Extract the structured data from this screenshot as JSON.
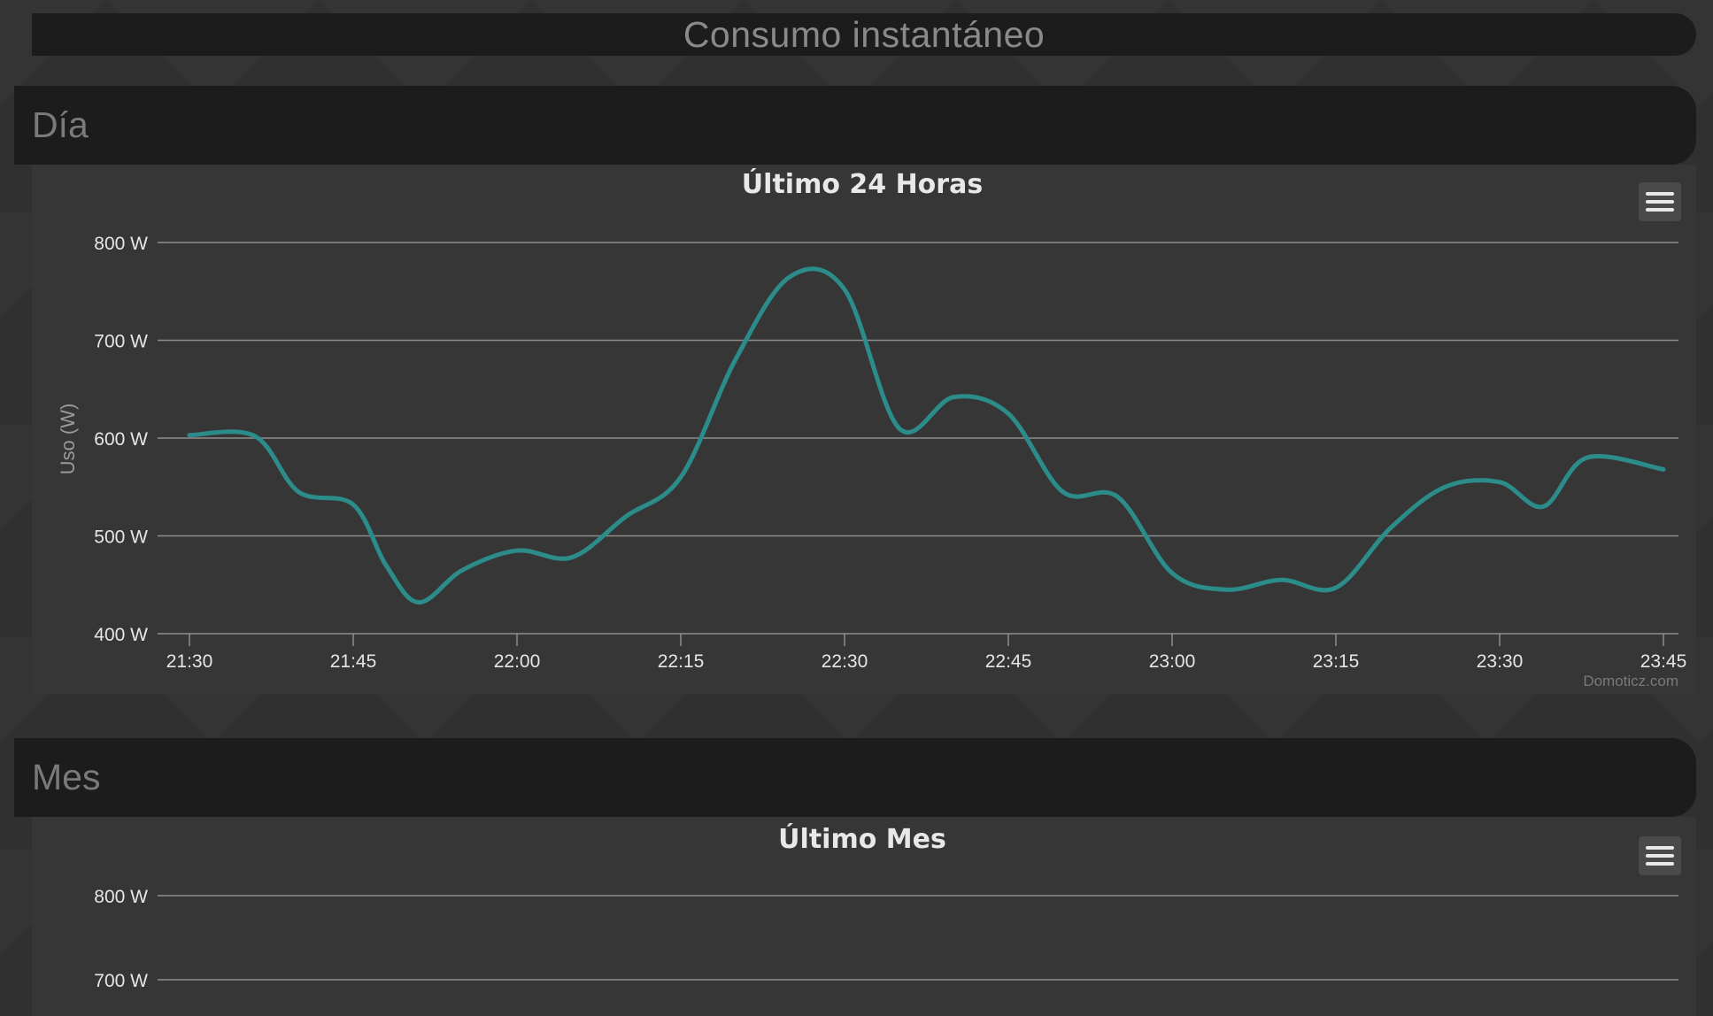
{
  "page_title": "Consumo instantáneo",
  "sections": {
    "dia": {
      "header": "Día"
    },
    "mes": {
      "header": "Mes"
    }
  },
  "colors": {
    "series": "#2b8c8a",
    "panel": "#363637",
    "header": "#1c1c1c"
  },
  "icons": {
    "menu": "hamburger-menu-icon"
  },
  "chart_data": [
    {
      "type": "line",
      "title": "Último 24 Horas",
      "xlabel": "",
      "ylabel": "Uso (W)",
      "ylim": [
        400,
        800
      ],
      "yticks": [
        "800 W",
        "700 W",
        "600 W",
        "500 W",
        "400 W"
      ],
      "xticks": [
        "21:30",
        "21:45",
        "22:00",
        "22:15",
        "22:30",
        "22:45",
        "23:00",
        "23:15",
        "23:30",
        "23:45"
      ],
      "x": [
        "21:30",
        "21:36",
        "21:40",
        "21:45",
        "21:48",
        "21:51",
        "21:55",
        "22:00",
        "22:05",
        "22:10",
        "22:15",
        "22:20",
        "22:25",
        "22:30",
        "22:35",
        "22:40",
        "22:45",
        "22:50",
        "22:55",
        "23:00",
        "23:05",
        "23:10",
        "23:15",
        "23:20",
        "23:25",
        "23:30",
        "23:34",
        "23:38",
        "23:45"
      ],
      "series": [
        {
          "values": [
            603,
            602,
            545,
            532,
            470,
            432,
            465,
            485,
            478,
            520,
            560,
            680,
            765,
            752,
            610,
            642,
            625,
            545,
            540,
            462,
            445,
            455,
            447,
            508,
            550,
            555,
            530,
            580,
            568
          ]
        }
      ],
      "grid": true,
      "credits": "Domoticz.com"
    },
    {
      "type": "line",
      "title": "Último Mes",
      "ylim": [
        400,
        800
      ],
      "yticks": [
        "800 W",
        "700 W"
      ],
      "series": []
    }
  ]
}
